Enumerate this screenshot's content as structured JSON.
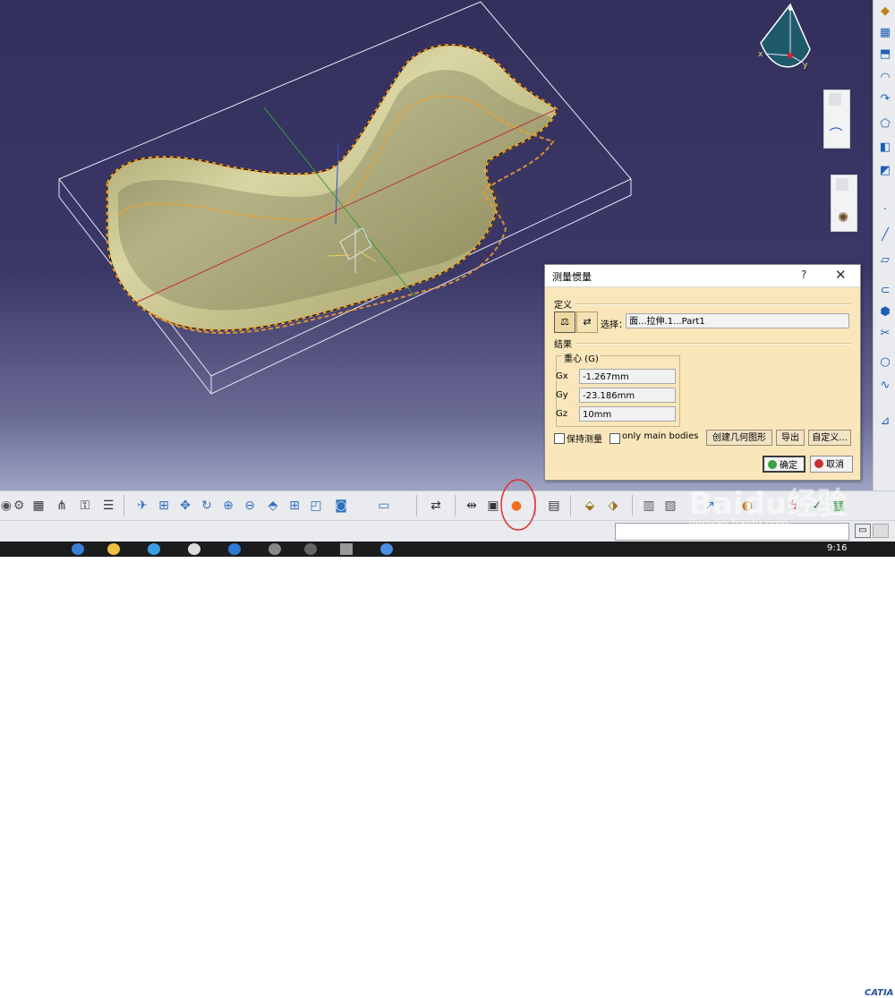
{
  "compass": {
    "axis_x": "x",
    "axis_y": "y"
  },
  "dialog": {
    "title": "测量惯量",
    "help_glyph": "?",
    "close_glyph": "✕",
    "definition_label": "定义",
    "selection_label": "选择：",
    "selection_value": "面...拉伸.1...Part1",
    "results_label": "结果",
    "cog_group_label": "重心 (G)",
    "gx_label": "Gx",
    "gx_value": "-1.267mm",
    "gy_label": "Gy",
    "gy_value": "-23.186mm",
    "gz_label": "Gz",
    "gz_value": "10mm",
    "keep_measure_label": "保持测量",
    "only_main_bodies_label": "only main bodies",
    "create_geometry_label": "创建几何图形",
    "export_label": "导出",
    "customize_label": "自定义...",
    "ok_label": "确定",
    "cancel_label": "取消"
  },
  "watermark": {
    "text": "Baidu经验",
    "url": "jingyan.baidu.com"
  },
  "catia_logo": "CATIA",
  "clock": "9:16",
  "colors": {
    "viewport_top": "#34305d",
    "dialog_bg": "#f9e7bb",
    "highlight_dash": "#f0a030",
    "surface": "#c9c78a"
  }
}
